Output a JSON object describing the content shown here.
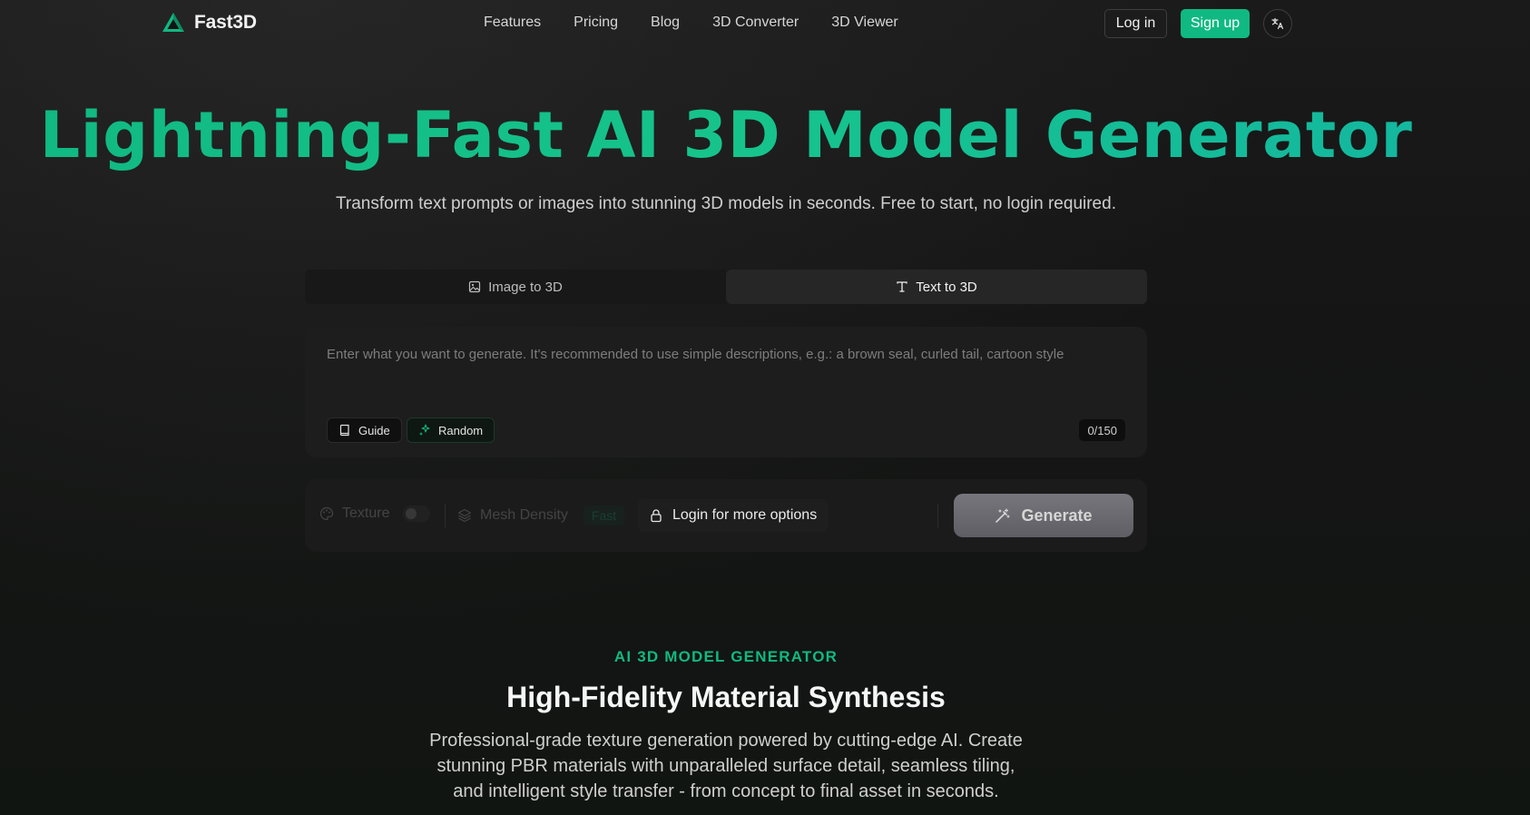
{
  "brand": {
    "name": "Fast3D",
    "accent": "#10b981"
  },
  "nav": {
    "links": [
      "Features",
      "Pricing",
      "Blog",
      "3D Converter",
      "3D Viewer"
    ],
    "login_label": "Log in",
    "signup_label": "Sign up",
    "language_icon": "translate-icon"
  },
  "hero": {
    "title": "Lightning-Fast AI 3D Model Generator",
    "subtitle": "Transform text prompts or images into stunning 3D models in seconds. Free to start, no login required."
  },
  "tabs": [
    {
      "label": "Image to 3D",
      "icon": "image-icon",
      "active": false
    },
    {
      "label": "Text to 3D",
      "icon": "text-icon",
      "active": true
    }
  ],
  "prompt": {
    "value": "",
    "placeholder": "Enter what you want to generate. It's recommended to use simple descriptions, e.g.: a brown seal, curled tail, cartoon style",
    "guide_label": "Guide",
    "random_label": "Random",
    "counter": "0/150"
  },
  "options": {
    "texture_label": "Texture",
    "mesh_density_label": "Mesh Density",
    "mesh_density_value": "Fast",
    "login_more_label": "Login for more options",
    "generate_label": "Generate"
  },
  "section": {
    "eyebrow": "AI 3D MODEL GENERATOR",
    "title": "High-Fidelity Material Synthesis",
    "description": "Professional-grade texture generation powered by cutting-edge AI. Create stunning PBR materials with unparalleled surface detail, seamless tiling, and intelligent style transfer - from concept to final asset in seconds."
  }
}
